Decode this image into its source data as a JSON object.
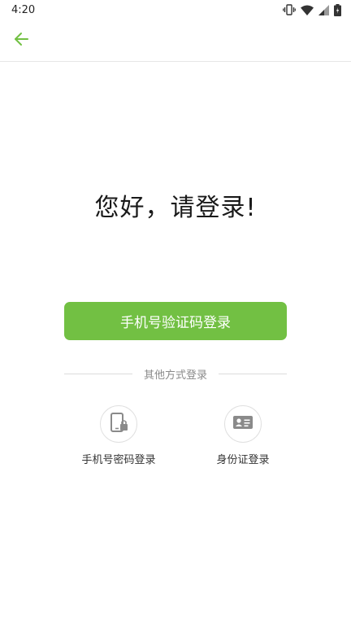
{
  "status_bar": {
    "time": "4:20",
    "icons": [
      "vibrate-icon",
      "wifi-icon",
      "signal-icon",
      "battery-icon"
    ]
  },
  "header": {
    "back_icon": "arrow-left-icon",
    "accent_color": "#72c043"
  },
  "main": {
    "greeting": "您好，请登录!",
    "primary_button": "手机号验证码登录",
    "primary_color": "#72c043",
    "divider_label": "其他方式登录",
    "alt_options": [
      {
        "icon": "phone-lock-icon",
        "label": "手机号密码登录"
      },
      {
        "icon": "id-card-icon",
        "label": "身份证登录"
      }
    ]
  }
}
